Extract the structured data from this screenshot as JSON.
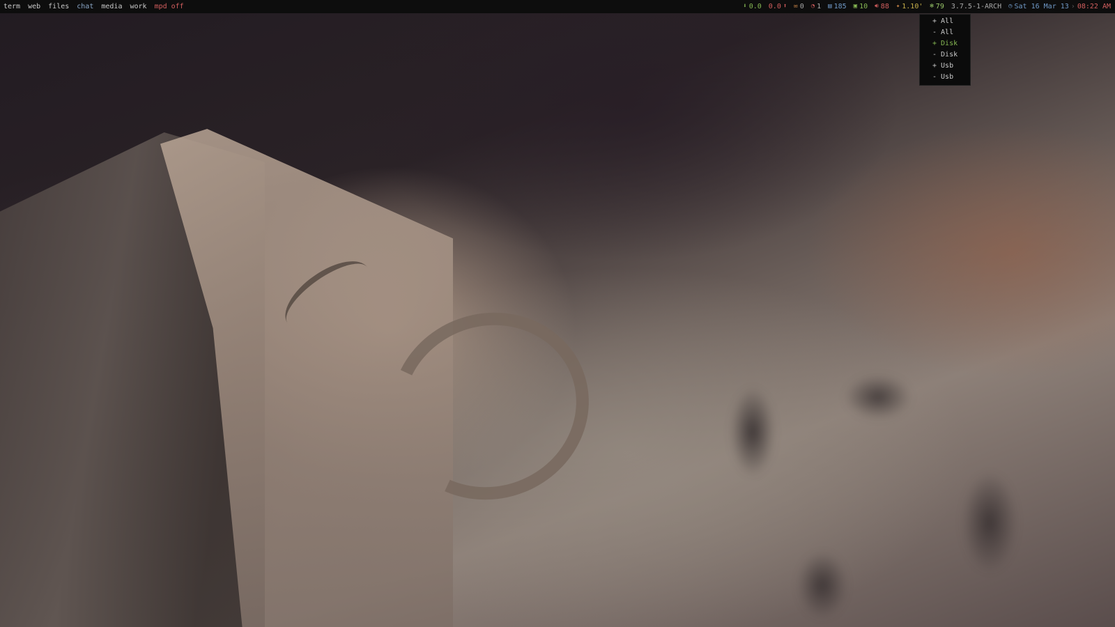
{
  "topbar": {
    "tags": [
      "term",
      "web",
      "files",
      "chat",
      "media",
      "work"
    ],
    "mpd": "mpd off",
    "net_down": "0.0",
    "net_up": "0.0",
    "mail": "0",
    "updates": "1",
    "mem": "185",
    "cpu": "10",
    "volume": "88",
    "load": "1.10'",
    "temp": "79",
    "kernel": "3.7.5-1-ARCH",
    "date": "Sat 16 Mar 13",
    "time": "08:22 AM"
  },
  "menu": {
    "items": [
      "+ All",
      "- All",
      "+ Disk",
      "- Disk",
      "+ Usb",
      "- Usb"
    ],
    "active_index": 2
  },
  "colors": {
    "accent_green": "#86b853",
    "accent_red": "#d25e5e",
    "accent_blue": "#6f98c6",
    "bar_bg": "#0d0d0d"
  }
}
